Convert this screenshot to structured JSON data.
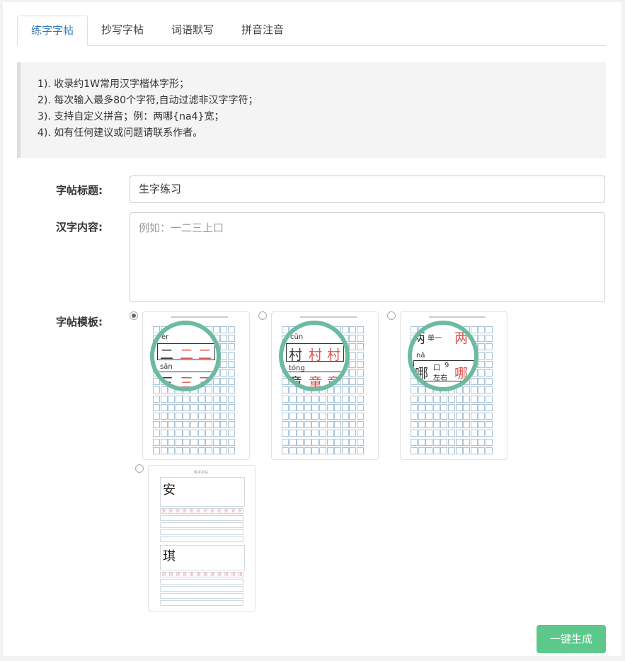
{
  "tabs": [
    {
      "label": "练字字帖",
      "active": true
    },
    {
      "label": "抄写字帖",
      "active": false
    },
    {
      "label": "词语默写",
      "active": false
    },
    {
      "label": "拼音注音",
      "active": false
    }
  ],
  "notes": [
    "1). 收录约1W常用汉字楷体字形；",
    "2). 每次输入最多80个字符,自动过滤非汉字字符；",
    "3). 支持自定义拼音；例：两哪{na4}宽；",
    "4). 如有任何建议或问题请联系作者。"
  ],
  "form": {
    "title_label": "字帖标题:",
    "title_value": "生字练习",
    "content_label": "汉字内容:",
    "content_placeholder": "例如：一二三上口",
    "template_label": "字帖模板:"
  },
  "templates": [
    {
      "selected": true,
      "mag": {
        "p1": "èr",
        "c1": "二",
        "p2": "sān",
        "c2": "三"
      }
    },
    {
      "selected": false,
      "mag": {
        "p1": "cūn",
        "c1": "村",
        "p2": "tóng",
        "c2": "童"
      }
    },
    {
      "selected": false,
      "mag": {
        "c1": "两",
        "p1": "nǎ",
        "c2": "哪",
        "s1": "单一",
        "s2": "口",
        "s3": "9",
        "s4": "左右"
      }
    },
    {
      "selected": false,
      "chars": [
        "安",
        "琪"
      ],
      "sheet_title": "练字字帖"
    }
  ],
  "generate_button": "一键生成",
  "colors": {
    "accent": "#337ab7",
    "button": "#5cc98a",
    "magnifier": "#6cbba0"
  }
}
